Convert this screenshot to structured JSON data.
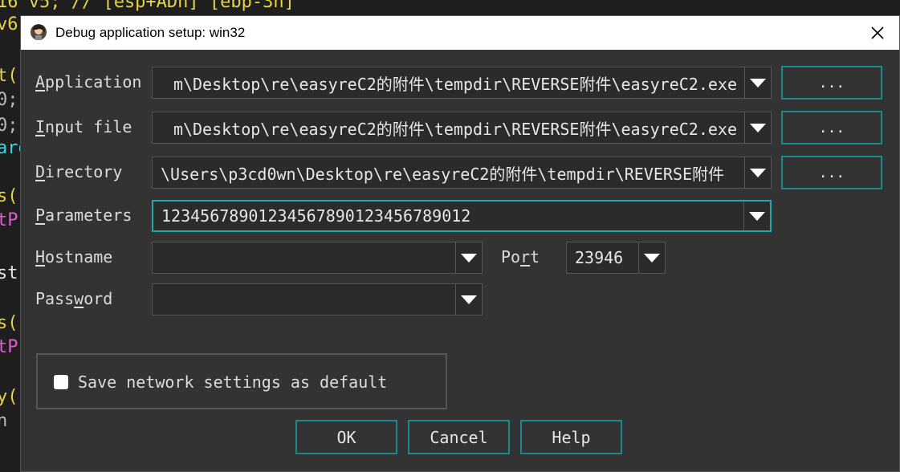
{
  "background_code": [
    {
      "text": "16 v5; // [esp+ADh] [ebp-3h]",
      "color": "#e6d34a"
    },
    {
      "text": "v6",
      "color": "#e6d34a"
    },
    {
      "text": "t(",
      "color": "#e6d34a"
    },
    {
      "text": "0;",
      "color": "#bbbbbb"
    },
    {
      "text": "0;",
      "color": "#bbbbbb"
    },
    {
      "text": "arg",
      "color": "#3fd4dd"
    },
    {
      "text": "s(",
      "color": "#e6d34a"
    },
    {
      "text": "tP",
      "color": "#e05ad6"
    },
    {
      "text": "st",
      "color": "#e6e6e6"
    },
    {
      "text": "s(",
      "color": "#e6d34a"
    },
    {
      "text": "tP",
      "color": "#e05ad6"
    },
    {
      "text": "y(",
      "color": "#e6d34a"
    },
    {
      "text": "n",
      "color": "#bbbbbb"
    }
  ],
  "dialog": {
    "title": "Debug application setup: win32",
    "close_label": "✕"
  },
  "fields": {
    "application": {
      "label_u": "A",
      "label_rest": "pplication",
      "value": "m\\Desktop\\re\\easyreC2的附件\\tempdir\\REVERSE附件\\easyreC2.exe"
    },
    "input_file": {
      "label_u": "I",
      "label_rest": "nput file",
      "value": "m\\Desktop\\re\\easyreC2的附件\\tempdir\\REVERSE附件\\easyreC2.exe"
    },
    "directory": {
      "label_u": "D",
      "label_rest": "irectory",
      "value": "\\Users\\p3cd0wn\\Desktop\\re\\easyreC2的附件\\tempdir\\REVERSE附件"
    },
    "parameters": {
      "label_u": "P",
      "label_rest": "arameters",
      "value": "12345678901234567890123456789012"
    },
    "hostname": {
      "label_u": "H",
      "label_rest": "ostname",
      "value": ""
    },
    "port": {
      "label_pre": "Po",
      "label_u": "r",
      "label_rest": "t",
      "value": "23946"
    },
    "password": {
      "label_pre": "Pass",
      "label_u": "w",
      "label_rest": "ord",
      "value": ""
    }
  },
  "browse_label": "...",
  "save_default": {
    "label": "Save network settings as default",
    "checked": false
  },
  "buttons": {
    "ok": "OK",
    "cancel": "Cancel",
    "help": "Help"
  }
}
